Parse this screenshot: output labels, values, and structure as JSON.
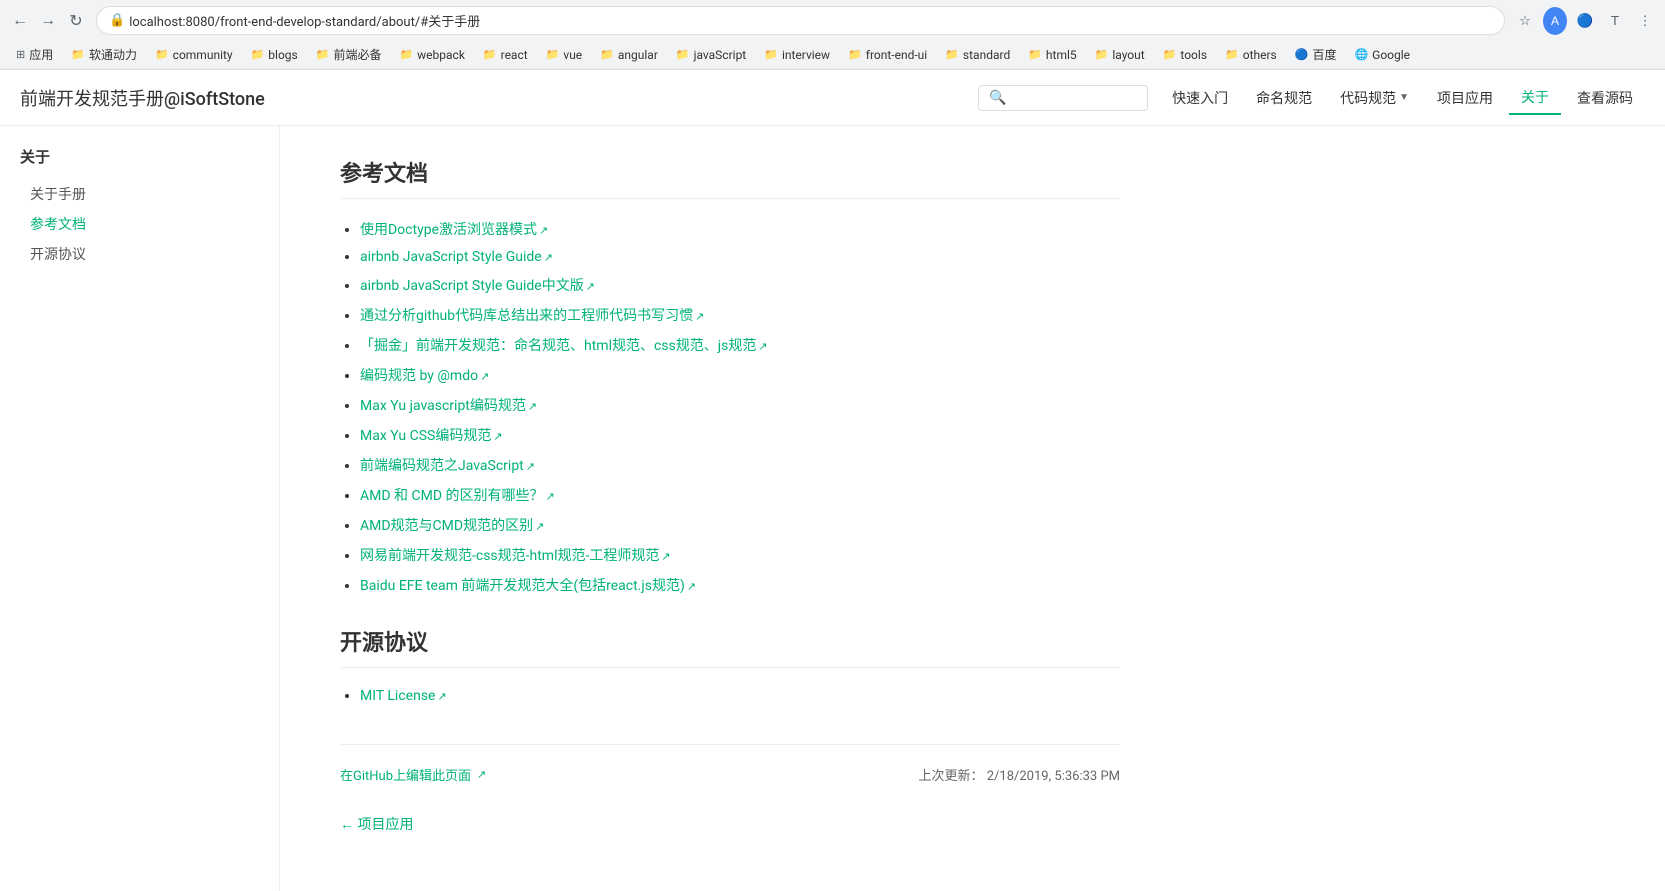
{
  "browser": {
    "url": "localhost:8080/front-end-develop-standard/about/#关于手册",
    "bookmarks": [
      {
        "label": "应用",
        "icon": "⊞"
      },
      {
        "label": "软通动力",
        "icon": "📁"
      },
      {
        "label": "community",
        "icon": "📁"
      },
      {
        "label": "blogs",
        "icon": "📁"
      },
      {
        "label": "前端必备",
        "icon": "📁"
      },
      {
        "label": "webpack",
        "icon": "📁"
      },
      {
        "label": "react",
        "icon": "📁"
      },
      {
        "label": "vue",
        "icon": "📁"
      },
      {
        "label": "angular",
        "icon": "📁"
      },
      {
        "label": "javaScript",
        "icon": "📁"
      },
      {
        "label": "interview",
        "icon": "📁"
      },
      {
        "label": "front-end-ui",
        "icon": "📁"
      },
      {
        "label": "standard",
        "icon": "📁"
      },
      {
        "label": "html5",
        "icon": "📁"
      },
      {
        "label": "layout",
        "icon": "📁"
      },
      {
        "label": "tools",
        "icon": "📁"
      },
      {
        "label": "others",
        "icon": "📁"
      },
      {
        "label": "百度",
        "icon": "🔵"
      },
      {
        "label": "Google",
        "icon": "🌐"
      }
    ]
  },
  "header": {
    "title": "前端开发规范手册@iSoftStone",
    "search_placeholder": "",
    "nav_items": [
      {
        "label": "快速入门",
        "active": false
      },
      {
        "label": "命名规范",
        "active": false
      },
      {
        "label": "代码规范",
        "active": false,
        "has_dropdown": true
      },
      {
        "label": "项目应用",
        "active": false
      },
      {
        "label": "关于",
        "active": true
      },
      {
        "label": "查看源码",
        "active": false
      }
    ]
  },
  "sidebar": {
    "section_title": "关于",
    "items": [
      {
        "label": "关于手册",
        "href": "#关于手册",
        "active": false
      },
      {
        "label": "参考文档",
        "href": "#参考文档",
        "active": true
      },
      {
        "label": "开源协议",
        "href": "#开源协议",
        "active": false
      }
    ]
  },
  "main": {
    "reference_docs": {
      "title": "参考文档",
      "links": [
        {
          "text": "使用Doctype激活浏览器模式",
          "external": true
        },
        {
          "text": "airbnb JavaScript Style Guide",
          "external": true
        },
        {
          "text": "airbnb JavaScript Style Guide中文版",
          "external": true
        },
        {
          "text": "通过分析github代码库总结出来的工程师代码书写习惯",
          "external": true
        },
        {
          "text": "「掘金」前端开发规范：命名规范、html规范、css规范、js规范",
          "external": true
        },
        {
          "text": "编码规范 by @mdo",
          "external": true
        },
        {
          "text": "Max Yu javascript编码规范",
          "external": true
        },
        {
          "text": "Max Yu CSS编码规范",
          "external": true
        },
        {
          "text": "前端编码规范之JavaScript",
          "external": true
        },
        {
          "text": "AMD 和 CMD 的区别有哪些？",
          "external": true
        },
        {
          "text": "AMD规范与CMD规范的区别",
          "external": true
        },
        {
          "text": "网易前端开发规范-css规范-html规范-工程师规范",
          "external": true
        },
        {
          "text": "Baidu EFE team 前端开发规范大全(包括react.js规范)",
          "external": true
        }
      ]
    },
    "open_source": {
      "title": "开源协议",
      "links": [
        {
          "text": "MIT License",
          "external": true
        }
      ]
    },
    "footer": {
      "edit_text": "在GitHub上编辑此页面",
      "edit_external": true,
      "last_updated_label": "上次更新：",
      "last_updated_value": "2/18/2019, 5:36:33 PM"
    },
    "prev_nav": {
      "arrow": "←",
      "label": "项目应用"
    }
  }
}
